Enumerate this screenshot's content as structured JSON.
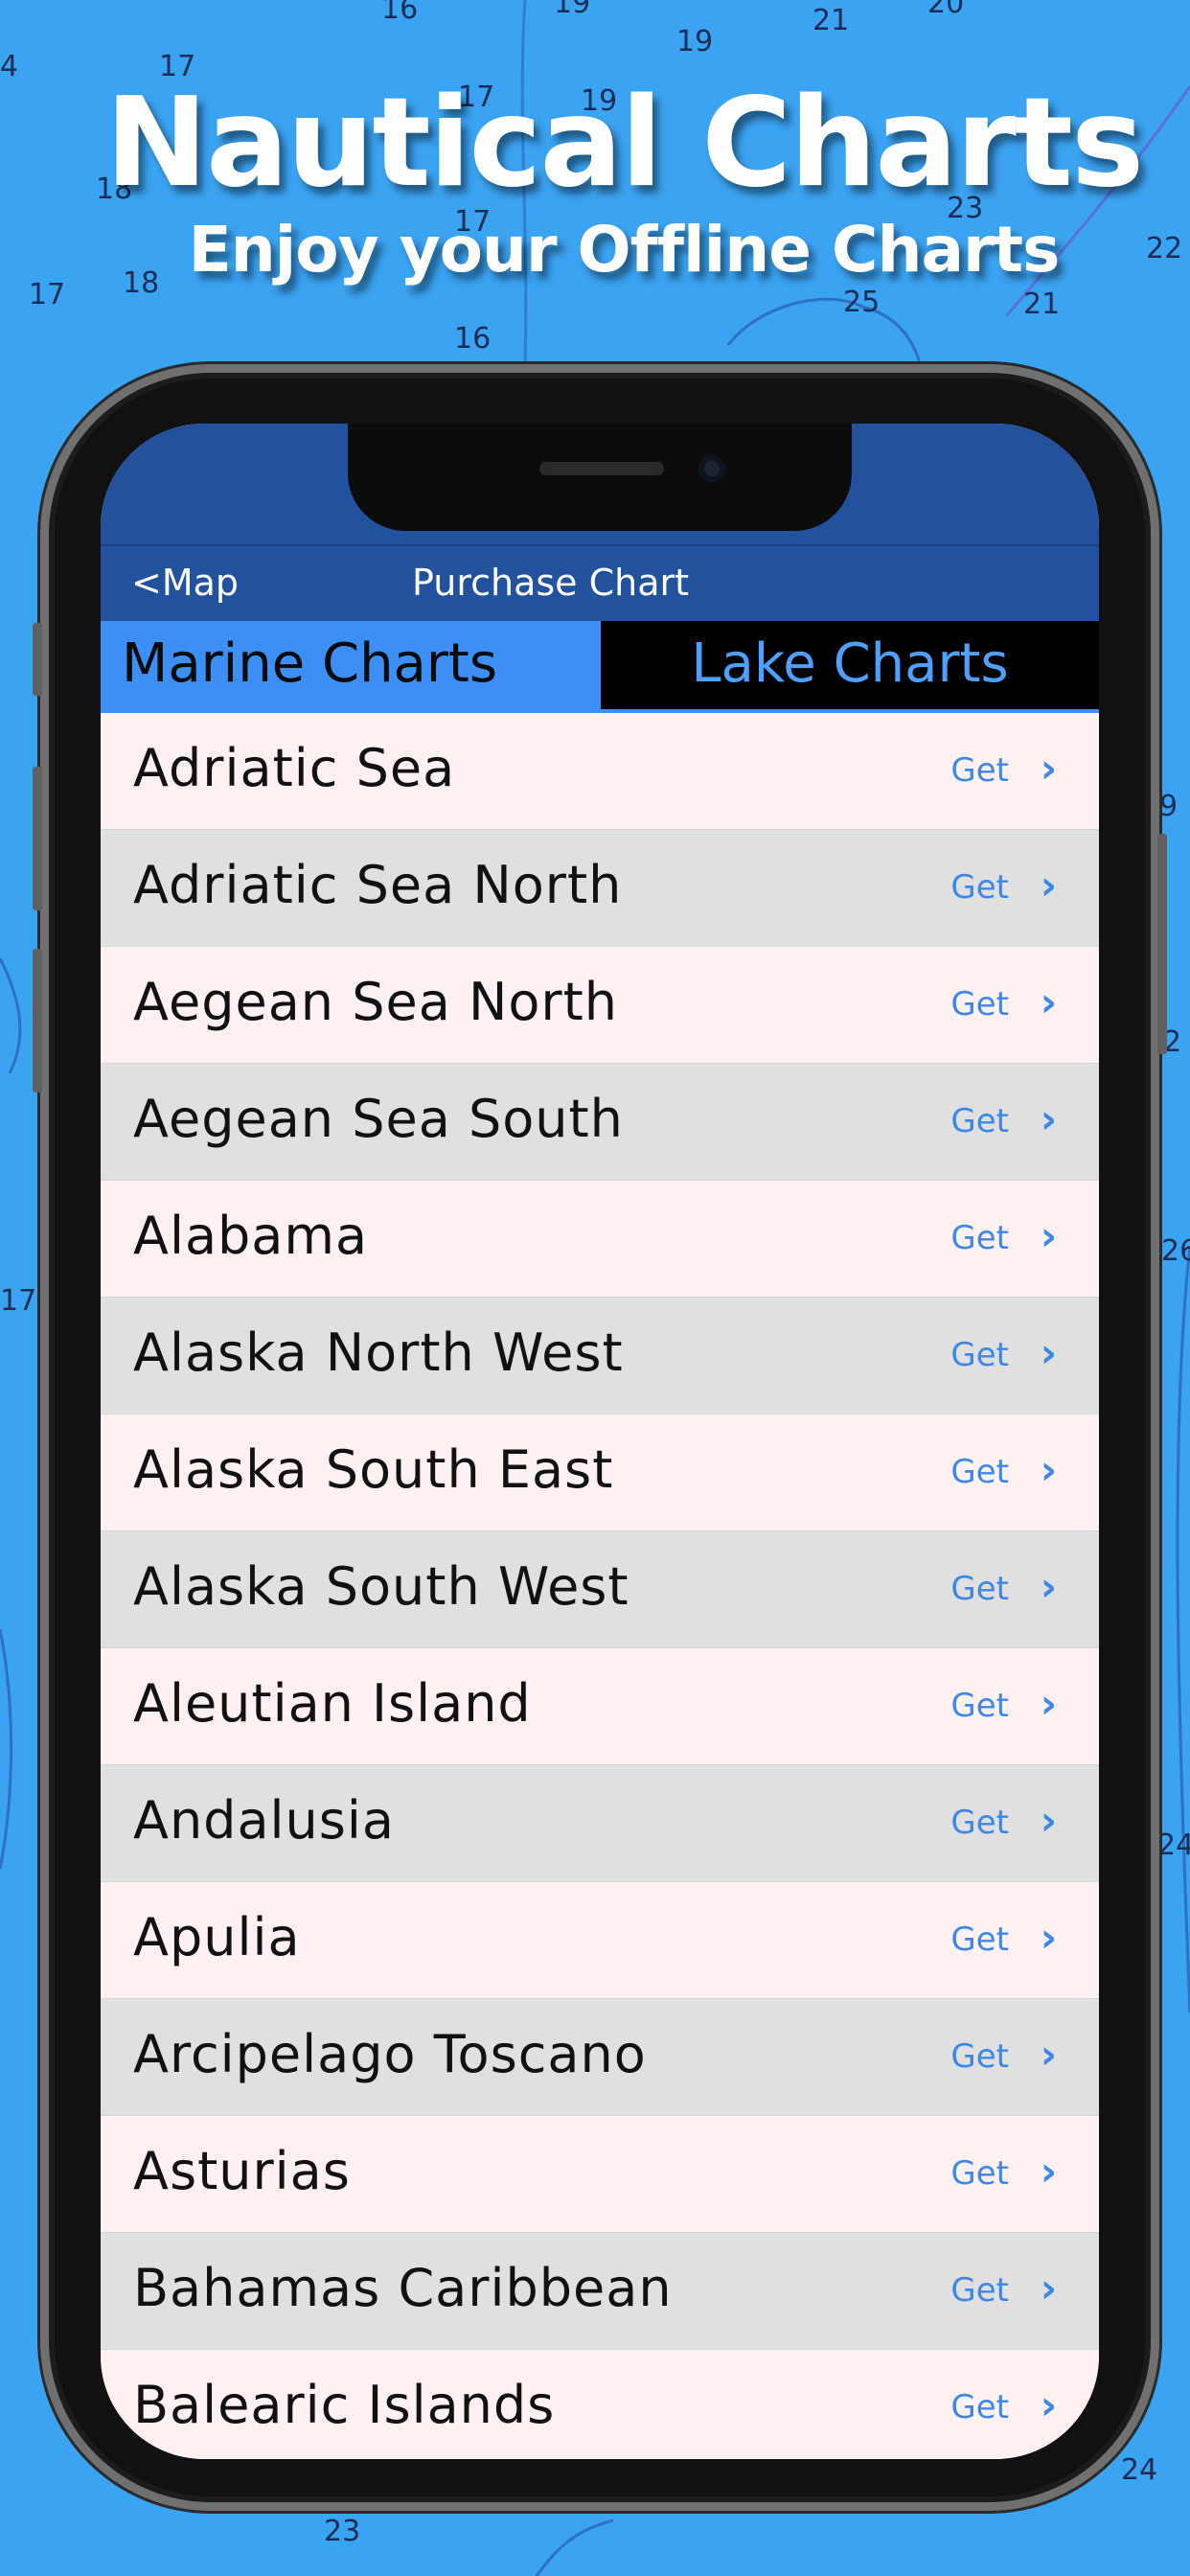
{
  "marketing": {
    "title": "Nautical Charts",
    "subtitle": "Enjoy your Offline Charts"
  },
  "background": {
    "depths": [
      "16",
      "19",
      "19",
      "21",
      "20",
      "4",
      "17",
      "17",
      "19",
      "18",
      "17",
      "23",
      "25",
      "21",
      "22",
      "17",
      "18",
      "16",
      "17",
      "9",
      "2",
      "26",
      "24",
      "23",
      "24"
    ]
  },
  "navbar": {
    "back_label": "<Map",
    "title": "Purchase Chart"
  },
  "tabs": {
    "marine": "Marine Charts",
    "lake": "Lake Charts"
  },
  "list": {
    "action_label": "Get",
    "chevron": "›",
    "items": [
      "Adriatic Sea",
      "Adriatic Sea North",
      "Aegean Sea North",
      "Aegean Sea South",
      "Alabama",
      "Alaska North West",
      "Alaska South East",
      "Alaska South West",
      "Aleutian Island",
      "Andalusia",
      "Apulia",
      "Arcipelago Toscano",
      "Asturias",
      "Bahamas Caribbean",
      "Balearic Islands"
    ]
  },
  "colors": {
    "sea": "#3aa3f2",
    "navbar": "#22529d",
    "tab_active": "#3b8ff5",
    "tab_inactive_text": "#4da0ff",
    "row_odd": "#fff0f2",
    "row_even": "#e0e0e0",
    "action": "#3d88e6"
  }
}
